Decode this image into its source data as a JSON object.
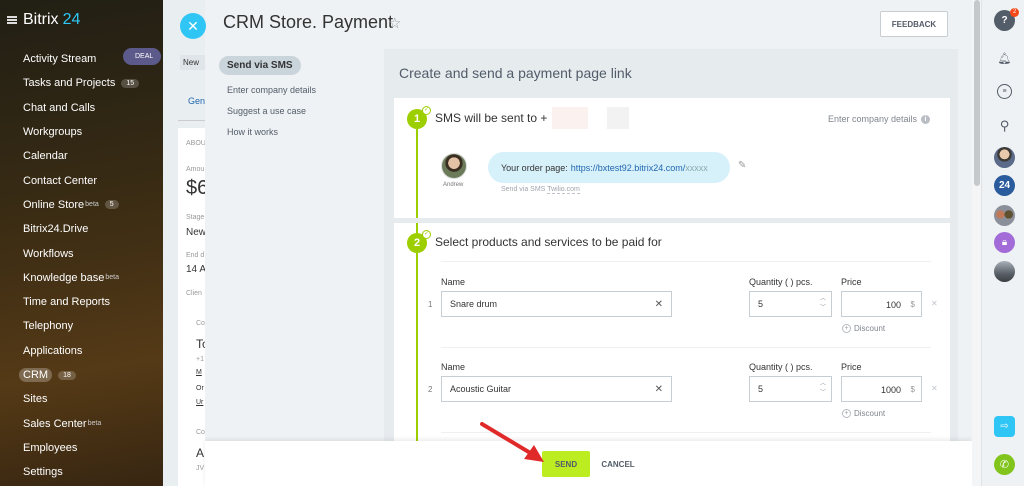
{
  "app": {
    "logo_text": "Bitrix",
    "logo_num": "24"
  },
  "sidebar": {
    "items": [
      {
        "label": "Activity Stream"
      },
      {
        "label": "Tasks and Projects",
        "count": "15"
      },
      {
        "label": "Chat and Calls"
      },
      {
        "label": "Workgroups"
      },
      {
        "label": "Calendar"
      },
      {
        "label": "Contact Center"
      },
      {
        "label": "Online Store",
        "sup": "beta",
        "count": "5"
      },
      {
        "label": "Bitrix24.Drive"
      },
      {
        "label": "Workflows"
      },
      {
        "label": "Knowledge base",
        "sup": "beta"
      },
      {
        "label": "Time and Reports"
      },
      {
        "label": "Telephony"
      },
      {
        "label": "Applications"
      },
      {
        "label": "CRM",
        "count": "18",
        "active": true
      },
      {
        "label": "Sites"
      },
      {
        "label": "Sales Center",
        "sup": "beta"
      },
      {
        "label": "Employees"
      },
      {
        "label": "Settings"
      }
    ]
  },
  "background": {
    "deal_tab": "DEAL",
    "new_label": "New",
    "tab_general": "Gen",
    "about": "ABOU",
    "amount_label": "Amou",
    "amount_value": "$6",
    "stage_label": "Stage",
    "stage_value": "New",
    "end_label": "End d",
    "end_value": "14 A",
    "client_label": "Clien",
    "c1": "Co",
    "c1_value": "To",
    "c1a": "+1",
    "c1b": "M",
    "c1c": "Or",
    "c1d": "Ur",
    "c2": "Co",
    "c2_value": "A",
    "c2a": "JV"
  },
  "slider": {
    "title": "CRM Store. Payment",
    "feedback_label": "FEEDBACK",
    "left_menu": [
      {
        "label": "Send via SMS",
        "active": true
      },
      {
        "label": "Enter company details"
      },
      {
        "label": "Suggest a use case"
      },
      {
        "label": "How it works"
      }
    ],
    "main_title": "Create and send a payment page link",
    "step1": {
      "num": "1",
      "title": "SMS will be sent to +",
      "company_link": "Enter company details",
      "avatar_name": "Andrew",
      "bubble_text": "Your order page:",
      "bubble_url": "https://bxtest92.bitrix24.com/",
      "bubble_url_tail": "xxxxx",
      "via_prefix": "Send via SMS",
      "via_provider": "Twilio.com"
    },
    "step2": {
      "num": "2",
      "title": "Select products and services to be paid for",
      "col_name": "Name",
      "col_qty": "Quantity ( ) pcs.",
      "col_price": "Price",
      "discount_label": "Discount",
      "currency": "$",
      "rows": [
        {
          "num": "1",
          "name": "Snare drum",
          "qty": "5",
          "price": "100"
        },
        {
          "num": "2",
          "name": "Acoustic Guitar",
          "qty": "5",
          "price": "1000"
        }
      ]
    },
    "footer": {
      "send_label": "SEND",
      "cancel_label": "CANCEL"
    }
  },
  "right_bar": {
    "help_badge": "2",
    "b24_label": "24"
  },
  "colors": {
    "accent_green": "#bbed21",
    "step_green": "#9dcf00",
    "link_blue": "#2067b0",
    "bitrix_blue": "#2fc6f6"
  }
}
